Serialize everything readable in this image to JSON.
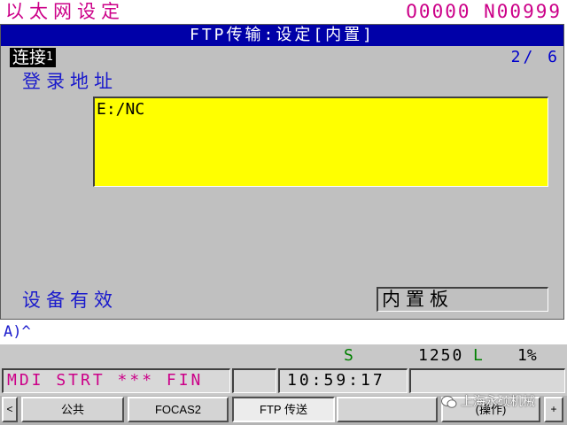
{
  "header": {
    "title": "以太网设定",
    "program": "O0000 N00999"
  },
  "panel": {
    "title": "FTP传输:设定[内置]",
    "connection_label": "连接",
    "connection_number": "1",
    "page_indicator": "2/ 6",
    "login_label": "登录地址",
    "login_value": "E:/NC",
    "device_label": "设备有效",
    "device_value": "内置板"
  },
  "input_line": "A)^",
  "status": {
    "s_code": "S",
    "s_value": "1250",
    "l_code": "L",
    "l_value": "1%",
    "mode": "MDI STRT *** FIN",
    "time": "10:59:17"
  },
  "softkeys": {
    "left_arrow": "<",
    "items": [
      "公共",
      "FOCAS2",
      "FTP 传送",
      "",
      "(操作)"
    ],
    "right_arrow": "+"
  },
  "watermark": "上海永硕机械",
  "colors": {
    "title_bar": "#0000a8",
    "panel_bg": "#c0c0c0",
    "input_highlight": "#ffff00",
    "label_blue": "#1a1acc",
    "header_magenta": "#cc0088",
    "status_green": "#008000"
  }
}
